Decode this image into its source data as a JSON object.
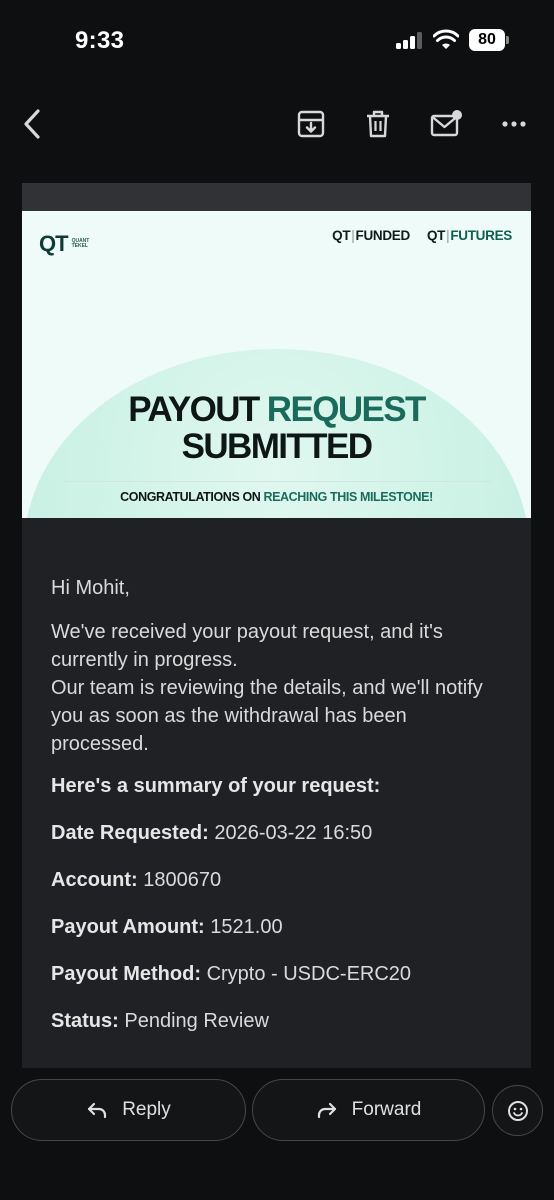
{
  "status_bar": {
    "time": "9:33",
    "battery": "80"
  },
  "toolbar": {
    "back_icon": "chevron-left-icon",
    "archive_icon": "archive-icon",
    "delete_icon": "trash-icon",
    "unread_icon": "mail-unread-icon",
    "more_icon": "more-horizontal-icon"
  },
  "banner": {
    "logo": "QT",
    "logo_sub_1": "QUANT",
    "logo_sub_2": "TEKEL",
    "brand_1_prefix": "QT",
    "brand_1_name": "FUNDED",
    "brand_2_prefix": "QT",
    "brand_2_name": "FUTURES",
    "headline_dark": "PAYOUT",
    "headline_green": "REQUEST",
    "headline_line2": "SUBMITTED",
    "congrats_dark": "CONGRATULATIONS ON",
    "congrats_green": "REACHING THIS MILESTONE!"
  },
  "email": {
    "greeting": "Hi Mohit,",
    "paragraph_1": "We've received your payout request, and it's currently in progress.",
    "paragraph_2": "Our team is reviewing the details, and we'll notify you as soon as the withdrawal has been processed.",
    "summary_title": "Here's a summary of your request:",
    "summary": [
      {
        "label": "Date Requested:",
        "value": "2026-03-22 16:50"
      },
      {
        "label": "Account:",
        "value": "1800670"
      },
      {
        "label": "Payout Amount:",
        "value": "1521.00"
      },
      {
        "label": "Payout Method:",
        "value": "Crypto - USDC-ERC20"
      },
      {
        "label": "Status:",
        "value": "Pending Review"
      }
    ]
  },
  "actions": {
    "reply_label": "Reply",
    "forward_label": "Forward"
  },
  "colors": {
    "background": "#0e0f11",
    "card": "#202124",
    "accent_green": "#1a6b5c"
  }
}
